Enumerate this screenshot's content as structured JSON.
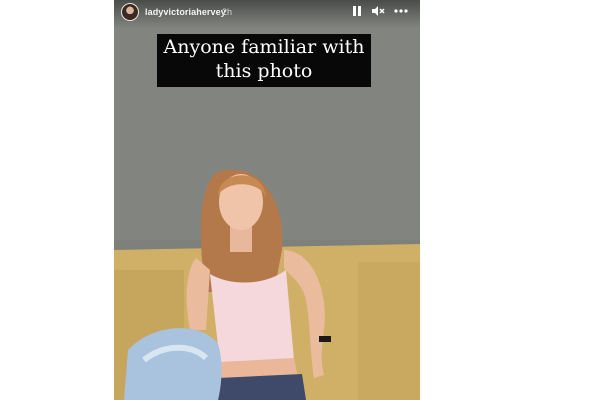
{
  "story": {
    "username": "ladyvictoriahervey",
    "time": "2h",
    "caption": "Anyone familiar with this photo",
    "controls": {
      "pause_icon": "pause-icon",
      "mute_icon": "speaker-muted-icon",
      "more_icon": "more-options-icon"
    }
  },
  "colors": {
    "wall": "#7c7e7b",
    "sofa": "#d2b36a",
    "caption_bg": "#080808"
  }
}
